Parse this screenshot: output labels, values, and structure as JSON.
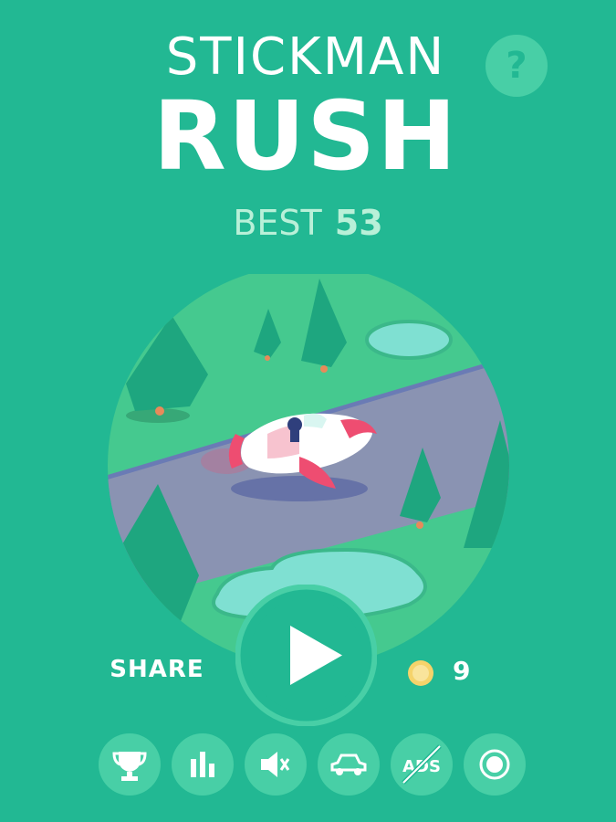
{
  "title": {
    "line1": "STICKMAN",
    "line2": "RUSH"
  },
  "help": {
    "label": "?"
  },
  "best": {
    "label": "BEST",
    "value": "53"
  },
  "share": {
    "label": "SHARE"
  },
  "coins": {
    "count": "9"
  },
  "play": {
    "icon": "play-icon"
  },
  "bottom_bar": {
    "items": [
      {
        "icon": "trophy-icon"
      },
      {
        "icon": "leaderboard-icon"
      },
      {
        "icon": "sound-muted-icon"
      },
      {
        "icon": "car-icon"
      },
      {
        "icon": "no-ads-icon",
        "label": "ADS"
      },
      {
        "icon": "record-icon"
      }
    ]
  },
  "colors": {
    "background": "#22b893",
    "button": "#48cfa6",
    "best_text": "#b9f0d8",
    "coin": "#f5d36b",
    "rocket": "#ee4d71"
  }
}
